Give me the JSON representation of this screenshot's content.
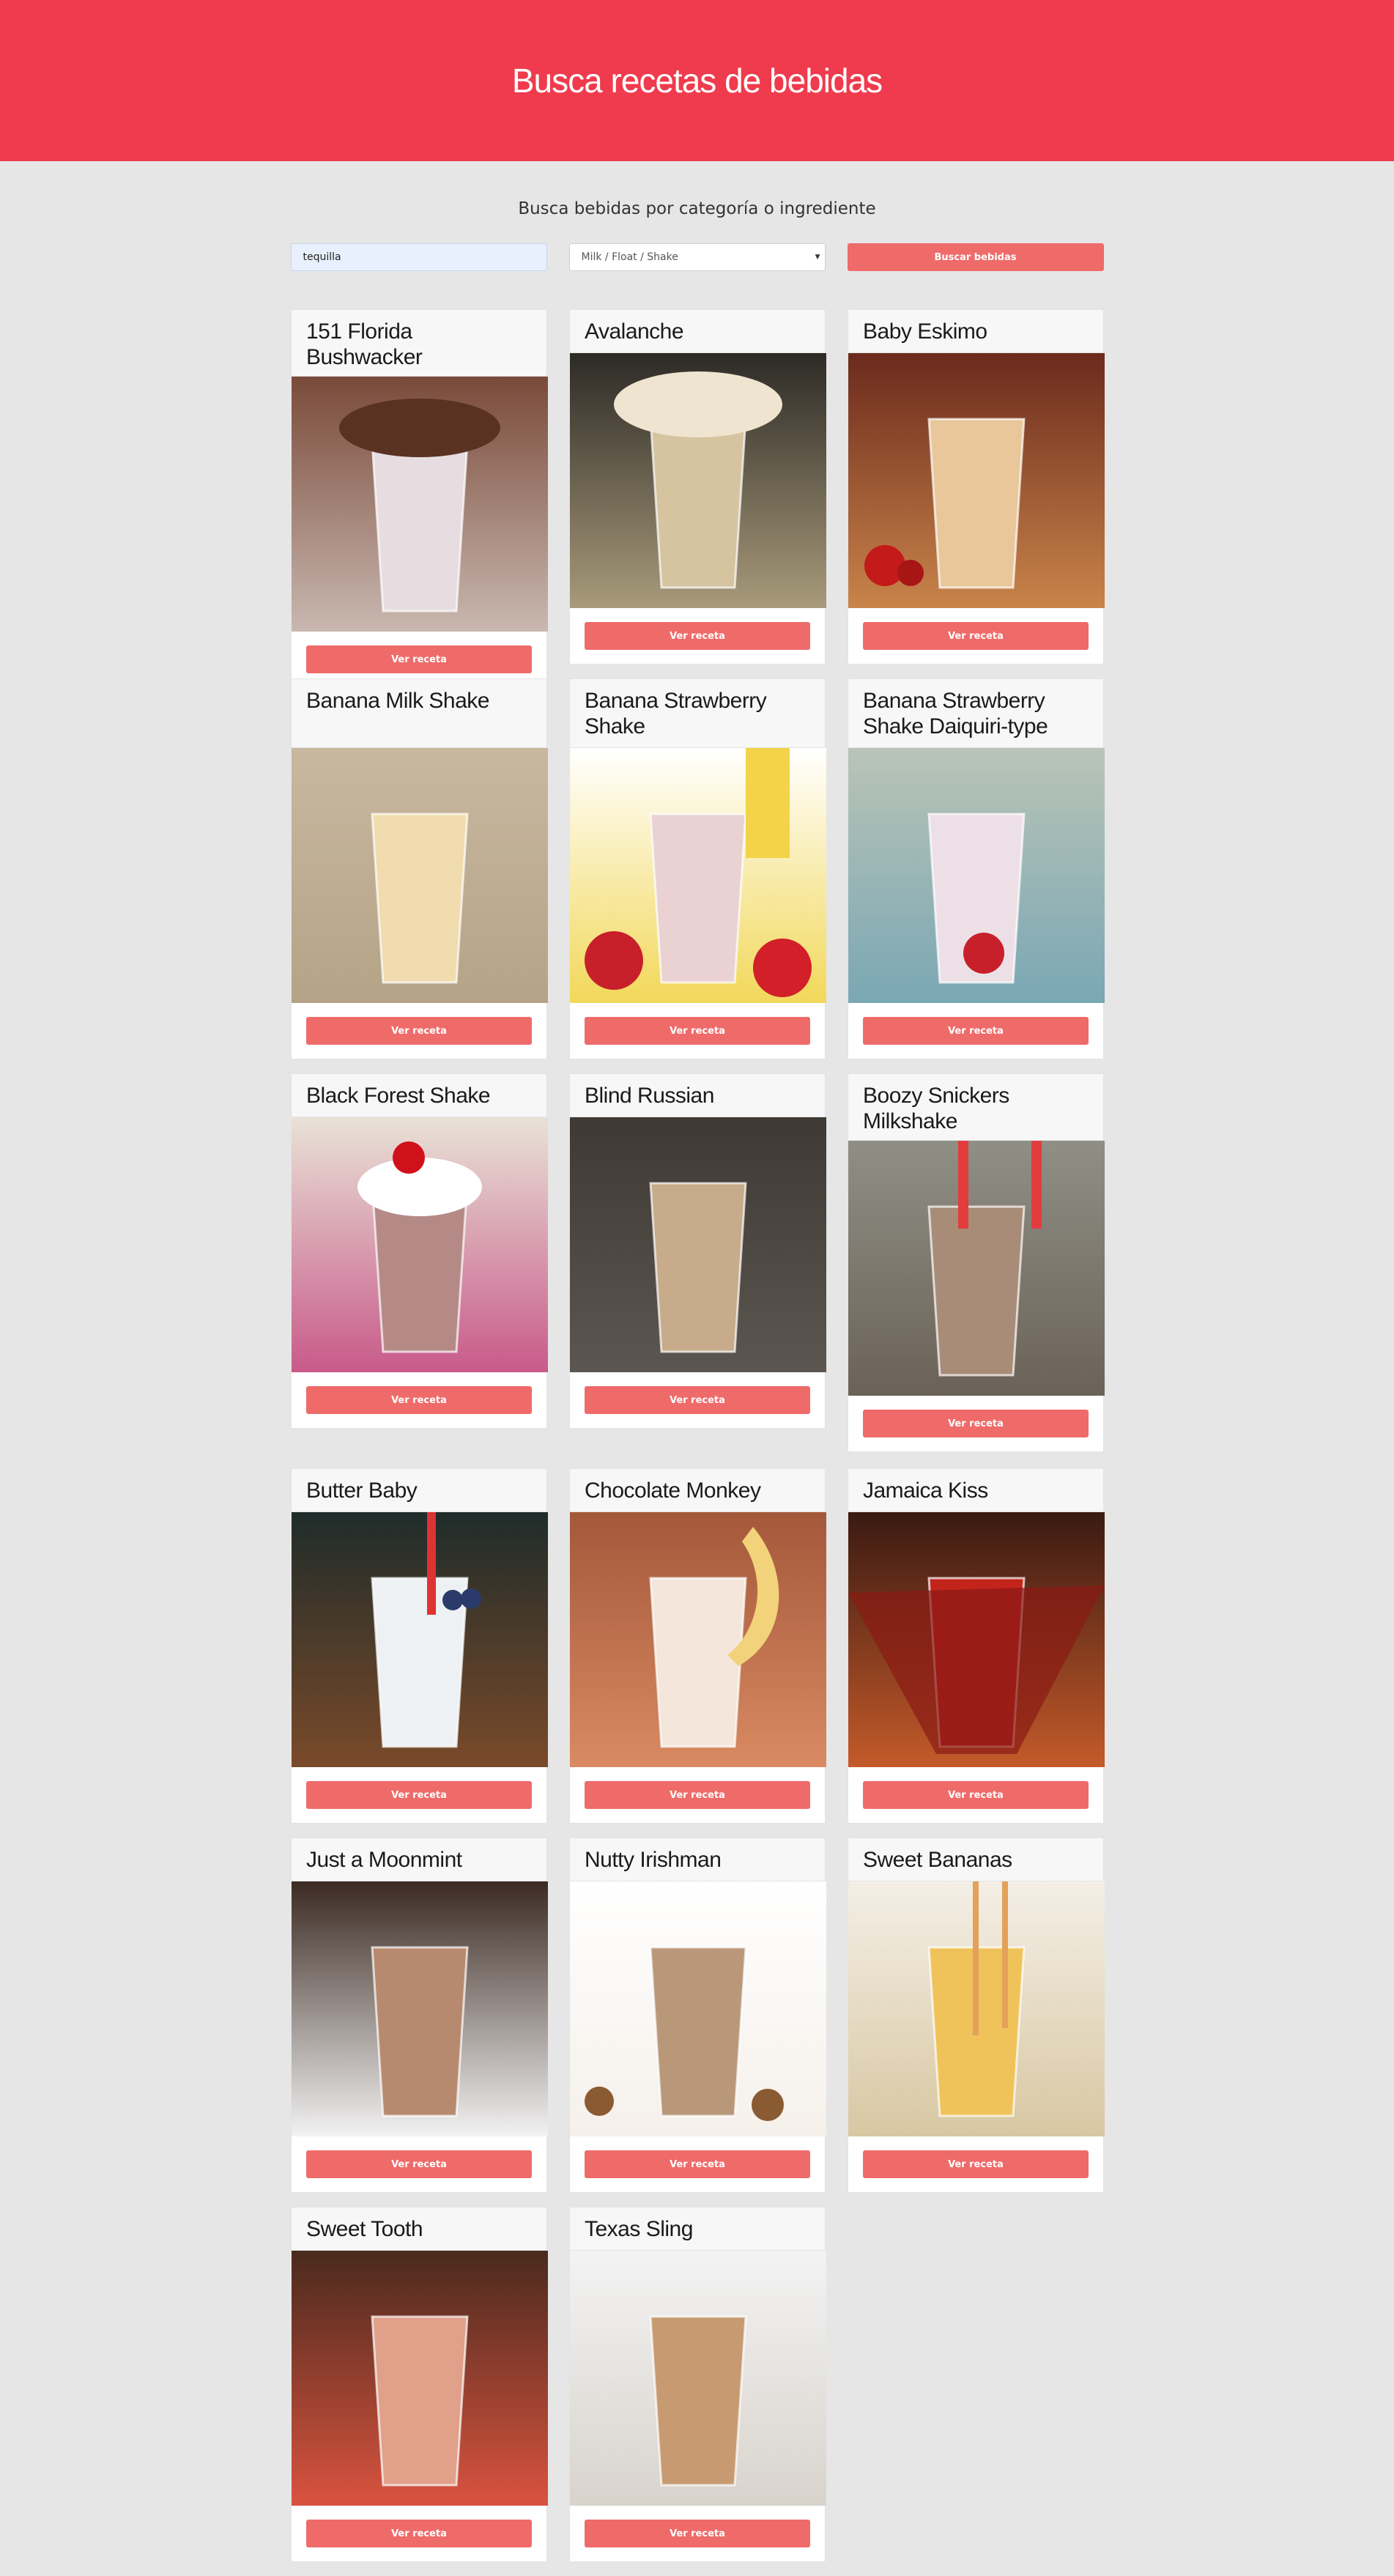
{
  "header": {
    "title": "Busca recetas de bebidas"
  },
  "search": {
    "subtitle": "Busca bebidas por categoría o ingrediente",
    "ingredient_value": "tequilla",
    "category_value": "Milk / Float / Shake",
    "submit_label": "Buscar bebidas"
  },
  "card_button_label": "Ver receta",
  "drinks": [
    {
      "name": "151 Florida Bushwacker",
      "img": "chocolate-shake"
    },
    {
      "name": "Avalanche",
      "img": "cream-glass"
    },
    {
      "name": "Baby Eskimo",
      "img": "holiday-glass"
    },
    {
      "name": "Banana Milk Shake",
      "img": "banana-shake"
    },
    {
      "name": "Banana Strawberry Shake",
      "img": "strawberry-banana"
    },
    {
      "name": "Banana Strawberry Shake Daiquiri-type",
      "img": "mason-jars"
    },
    {
      "name": "Black Forest Shake",
      "img": "cherry-shake"
    },
    {
      "name": "Blind Russian",
      "img": "foam-glass"
    },
    {
      "name": "Boozy Snickers Milkshake",
      "img": "snickers-jars"
    },
    {
      "name": "Butter Baby",
      "img": "berry-mug"
    },
    {
      "name": "Chocolate Monkey",
      "img": "choc-banana"
    },
    {
      "name": "Jamaica Kiss",
      "img": "red-martini"
    },
    {
      "name": "Just a Moonmint",
      "img": "hurricane-glass"
    },
    {
      "name": "Nutty Irishman",
      "img": "hazelnut-glass"
    },
    {
      "name": "Sweet Bananas",
      "img": "banana-jar"
    },
    {
      "name": "Sweet Tooth",
      "img": "pink-glass"
    },
    {
      "name": "Texas Sling",
      "img": "tulip-glass"
    }
  ],
  "colors": {
    "brand": "#ef3b4d",
    "button": "#ee6b6a",
    "page_bg": "#e6e6e6"
  }
}
